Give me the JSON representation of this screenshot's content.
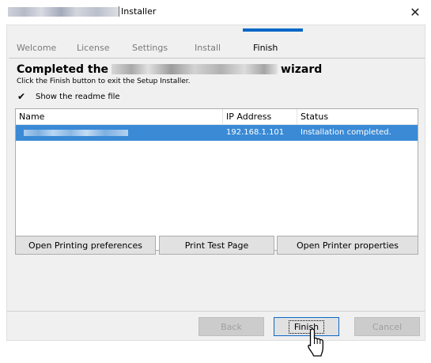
{
  "window": {
    "title": "Installer",
    "close_glyph": "✕"
  },
  "steps": [
    {
      "label": "Welcome",
      "active": false
    },
    {
      "label": "License",
      "active": false
    },
    {
      "label": "Settings",
      "active": false
    },
    {
      "label": "Install",
      "active": false
    },
    {
      "label": "Finish",
      "active": true
    }
  ],
  "heading": {
    "prefix": "Completed the",
    "suffix": "wizard"
  },
  "subtext": "Click the Finish button to exit the Setup Installer.",
  "readme": {
    "checked": true,
    "check_glyph": "✔",
    "label": "Show the readme file"
  },
  "table": {
    "columns": [
      "Name",
      "IP Address",
      "Status"
    ],
    "rows": [
      {
        "ip": "192.168.1.101",
        "status": "Installation completed.",
        "selected": true
      }
    ]
  },
  "actions": {
    "printing_preferences": "Open Printing preferences",
    "print_test_page": "Print Test Page",
    "printer_properties": "Open Printer properties"
  },
  "footer": {
    "back": "Back",
    "finish": "Finish",
    "cancel": "Cancel"
  },
  "colors": {
    "accent": "#0a68c7",
    "selection": "#3a8ad6"
  }
}
